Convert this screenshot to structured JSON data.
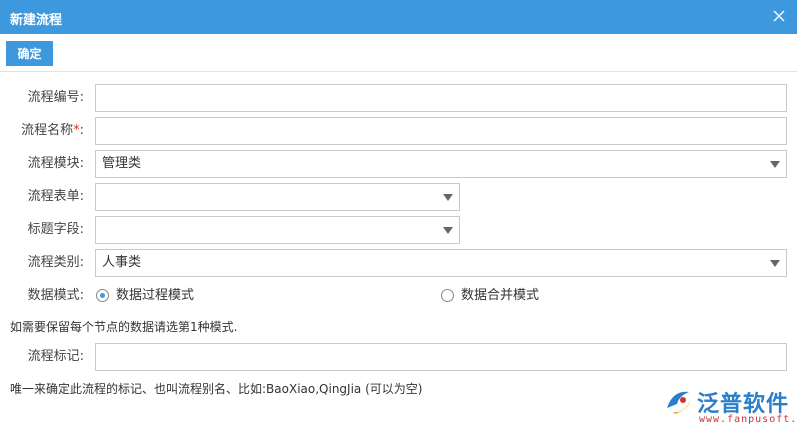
{
  "dialog": {
    "title": "新建流程",
    "close_icon": "close-icon"
  },
  "toolbar": {
    "confirm_label": "确定"
  },
  "form": {
    "process_number": {
      "label": "流程编号:",
      "value": ""
    },
    "process_name": {
      "label": "流程名称",
      "required_mark": "*",
      "colon": ":",
      "value": ""
    },
    "process_module": {
      "label": "流程模块:",
      "selected": "管理类"
    },
    "process_form": {
      "label": "流程表单:",
      "selected": ""
    },
    "title_field": {
      "label": "标题字段:",
      "selected": ""
    },
    "process_category": {
      "label": "流程类别:",
      "selected": "人事类"
    },
    "data_mode": {
      "label": "数据模式:",
      "options": [
        {
          "label": "数据过程模式",
          "selected": true
        },
        {
          "label": "数据合并模式",
          "selected": false
        }
      ]
    },
    "data_mode_note": "如需要保留每个节点的数据请选第1种模式.",
    "process_tag": {
      "label": "流程标记:",
      "value": ""
    },
    "process_tag_note": "唯一来确定此流程的标记、也叫流程别名、比如:BaoXiao,QingJia (可以为空)"
  },
  "watermark": {
    "brand": "泛普软件",
    "url": "www.fanpusoft.com",
    "accent": "#2a7fc7"
  },
  "colors": {
    "header": "#3d98de",
    "required": "#e03030"
  }
}
